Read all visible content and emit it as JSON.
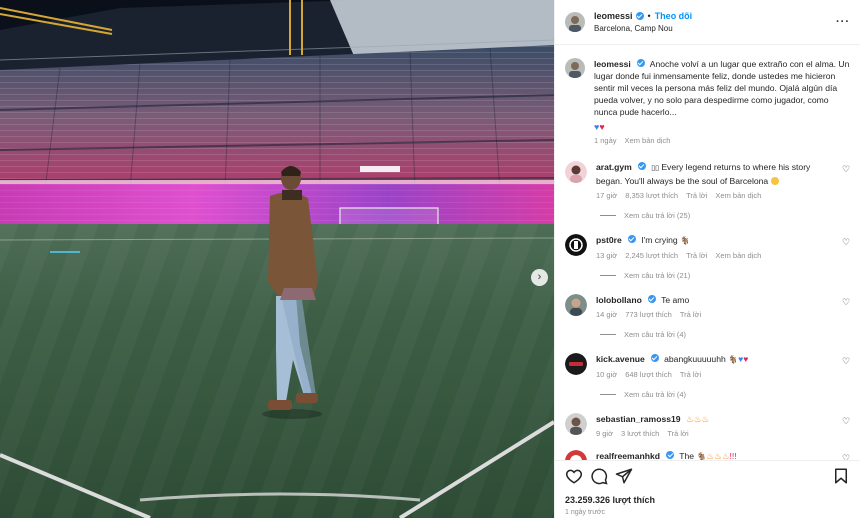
{
  "post": {
    "author": "leomessi",
    "follow_label": "Theo dõi",
    "location": "Barcelona, Camp Nou",
    "caption": "Anoche volví a un lugar que extraño con el alma. Un lugar donde fui inmensamente feliz, donde ustedes me hicieron sentir mil veces la persona más feliz del mundo. Ojalá algún día pueda volver, y no solo para despedirme como jugador, como nunca pude hacerlo...",
    "caption_time": "1 ngày",
    "caption_translate": "Xem bản dịch",
    "likes": "23.259.326 lượt thích",
    "posted": "1 ngày trước"
  },
  "comments": [
    {
      "user": "arat.gym",
      "text": "Every legend returns to where his story began. You'll always be the soul of Barcelona",
      "time": "17 giờ",
      "likes": "8,353 lượt thích",
      "reply": "Trả lời",
      "translate": "Xem bản dịch",
      "replies": "Xem câu trả lời (25)"
    },
    {
      "user": "pst0re",
      "text": "I'm crying",
      "time": "13 giờ",
      "likes": "2,245 lượt thích",
      "reply": "Trả lời",
      "translate": "Xem bản dịch",
      "replies": "Xem câu trả lời (21)"
    },
    {
      "user": "lolobollano",
      "text": "Te amo",
      "time": "14 giờ",
      "likes": "773 lượt thích",
      "reply": "Trả lời",
      "replies": "Xem câu trả lời (4)"
    },
    {
      "user": "kick.avenue",
      "text": "abangkuuuuuhh",
      "time": "10 giờ",
      "likes": "648 lượt thích",
      "reply": "Trả lời",
      "replies": "Xem câu trả lời (4)"
    },
    {
      "user": "sebastian_ramoss19",
      "text": "",
      "time": "9 giờ",
      "likes": "3 lượt thích",
      "reply": "Trả lời"
    },
    {
      "user": "realfreemanhkd",
      "text": "The",
      "time": "",
      "likes": "",
      "reply": ""
    }
  ],
  "colors": {
    "accent": "#0095f6",
    "verified": "#3897f0",
    "muted": "#8e8e8e"
  }
}
